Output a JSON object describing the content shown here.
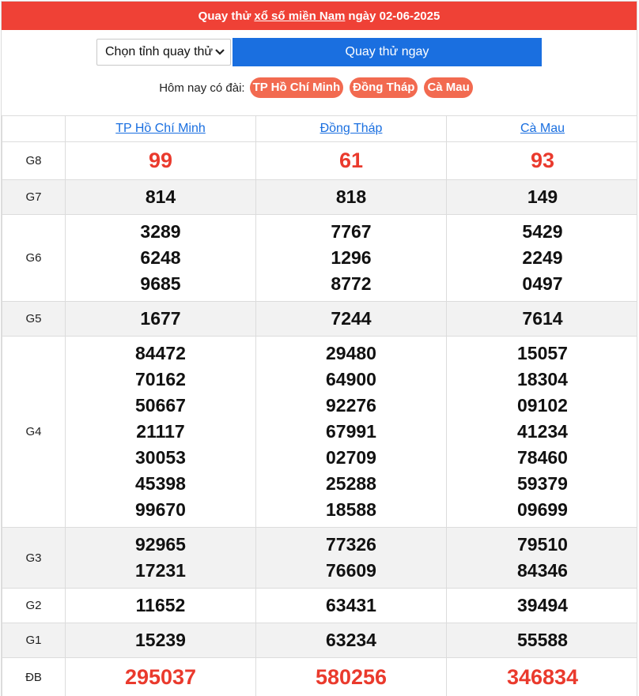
{
  "header": {
    "prefix": "Quay thử",
    "link": "xổ số miền Nam",
    "suffix": "ngày 02-06-2025"
  },
  "controls": {
    "select_value": "Chọn tỉnh quay thử",
    "spin_button": "Quay thử ngay"
  },
  "today": {
    "label": "Hôm nay có đài:",
    "provinces": [
      "TP Hồ Chí Minh",
      "Đồng Tháp",
      "Cà Mau"
    ]
  },
  "table": {
    "columns": [
      "TP Hồ Chí Minh",
      "Đồng Tháp",
      "Cà Mau"
    ],
    "rows": [
      {
        "prize": "G8",
        "values": [
          [
            "99"
          ],
          [
            "61"
          ],
          [
            "93"
          ]
        ]
      },
      {
        "prize": "G7",
        "values": [
          [
            "814"
          ],
          [
            "818"
          ],
          [
            "149"
          ]
        ]
      },
      {
        "prize": "G6",
        "values": [
          [
            "3289",
            "6248",
            "9685"
          ],
          [
            "7767",
            "1296",
            "8772"
          ],
          [
            "5429",
            "2249",
            "0497"
          ]
        ]
      },
      {
        "prize": "G5",
        "values": [
          [
            "1677"
          ],
          [
            "7244"
          ],
          [
            "7614"
          ]
        ]
      },
      {
        "prize": "G4",
        "values": [
          [
            "84472",
            "70162",
            "50667",
            "21117",
            "30053",
            "45398",
            "99670"
          ],
          [
            "29480",
            "64900",
            "92276",
            "67991",
            "02709",
            "25288",
            "18588"
          ],
          [
            "15057",
            "18304",
            "09102",
            "41234",
            "78460",
            "59379",
            "09699"
          ]
        ]
      },
      {
        "prize": "G3",
        "values": [
          [
            "92965",
            "17231"
          ],
          [
            "77326",
            "76609"
          ],
          [
            "79510",
            "84346"
          ]
        ]
      },
      {
        "prize": "G2",
        "values": [
          [
            "11652"
          ],
          [
            "63431"
          ],
          [
            "39494"
          ]
        ]
      },
      {
        "prize": "G1",
        "values": [
          [
            "15239"
          ],
          [
            "63234"
          ],
          [
            "55588"
          ]
        ]
      },
      {
        "prize": "ĐB",
        "values": [
          [
            "295037"
          ],
          [
            "580256"
          ],
          [
            "346834"
          ]
        ]
      }
    ]
  },
  "colors": {
    "header_bg": "#ef4136",
    "button_bg": "#1a6fe0",
    "pill_bg": "#f26a50",
    "highlight": "#ea3a2d"
  }
}
